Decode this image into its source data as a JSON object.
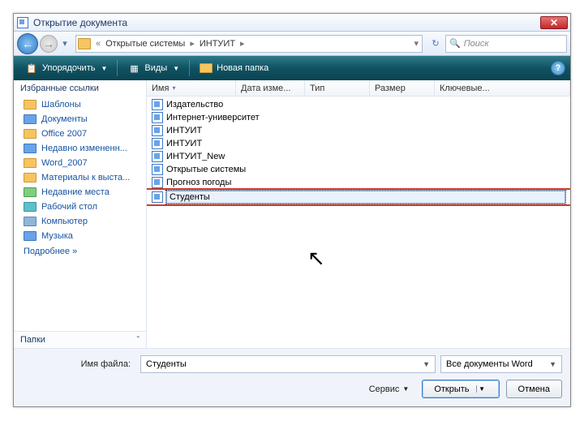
{
  "title": "Открытие документа",
  "breadcrumb": {
    "item1": "Открытые системы",
    "item2": "ИНТУИТ"
  },
  "search": {
    "placeholder": "Поиск"
  },
  "toolbar": {
    "organize": "Упорядочить",
    "views": "Виды",
    "newfolder": "Новая папка"
  },
  "sidebar": {
    "favorites_title": "Избранные ссылки",
    "items": [
      {
        "label": "Шаблоны",
        "icon": "folder"
      },
      {
        "label": "Документы",
        "icon": "blue"
      },
      {
        "label": "Office 2007",
        "icon": "folder"
      },
      {
        "label": "Недавно измененн...",
        "icon": "blue"
      },
      {
        "label": "Word_2007",
        "icon": "folder"
      },
      {
        "label": "Материалы к выста...",
        "icon": "folder"
      },
      {
        "label": "Недавние места",
        "icon": "green"
      },
      {
        "label": "Рабочий стол",
        "icon": "teal"
      },
      {
        "label": "Компьютер",
        "icon": "mon"
      },
      {
        "label": "Музыка",
        "icon": "blue"
      }
    ],
    "more": "Подробнее  »",
    "folders": "Папки"
  },
  "columns": {
    "name": "Имя",
    "date": "Дата изме...",
    "type": "Тип",
    "size": "Размер",
    "keywords": "Ключевые..."
  },
  "files": [
    "Издательство",
    "Интернет-университет",
    "ИНТУИТ",
    "ИНТУИТ",
    "ИНТУИТ_New",
    "Открытые системы",
    "Прогноз погоды"
  ],
  "selected_file": "Студенты",
  "bottom": {
    "filename_label": "Имя файла:",
    "filename_value": "Студенты",
    "filetype_value": "Все документы Word",
    "tools": "Сервис",
    "open": "Открыть",
    "cancel": "Отмена"
  }
}
